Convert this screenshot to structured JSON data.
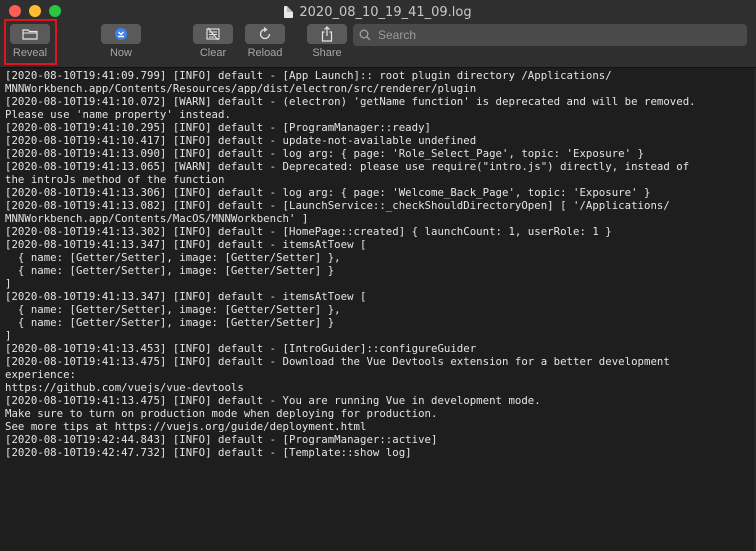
{
  "window": {
    "title": "2020_08_10_19_41_09.log"
  },
  "toolbar": {
    "items": [
      {
        "label": "Reveal",
        "icon": "folder-icon"
      },
      {
        "label": "Now",
        "icon": "now-icon"
      },
      {
        "label": "Clear",
        "icon": "clear-icon"
      },
      {
        "label": "Reload",
        "icon": "reload-icon"
      },
      {
        "label": "Share",
        "icon": "share-icon"
      }
    ],
    "search_placeholder": "Search"
  },
  "colors": {
    "toolbar_bg": "#2f2f2f",
    "log_bg": "#1e1e1e",
    "log_text": "#e4e4e4",
    "highlight": "#e0141b",
    "now_accent": "#3b82f6"
  },
  "log": {
    "lines": [
      "[2020-08-10T19:41:09.799] [INFO] default - [App Launch]:: root plugin directory /Applications/",
      "MNNWorkbench.app/Contents/Resources/app/dist/electron/src/renderer/plugin",
      "[2020-08-10T19:41:10.072] [WARN] default - (electron) 'getName function' is deprecated and will be removed.",
      "Please use 'name property' instead.",
      "[2020-08-10T19:41:10.295] [INFO] default - [ProgramManager::ready]",
      "[2020-08-10T19:41:10.417] [INFO] default - update-not-available undefined",
      "[2020-08-10T19:41:13.090] [INFO] default - log arg: { page: 'Role_Select_Page', topic: 'Exposure' }",
      "[2020-08-10T19:41:13.065] [WARN] default - Deprecated: please use require(\"intro.js\") directly, instead of",
      "the introJs method of the function",
      "[2020-08-10T19:41:13.306] [INFO] default - log arg: { page: 'Welcome_Back_Page', topic: 'Exposure' }",
      "[2020-08-10T19:41:13.082] [INFO] default - [LaunchService::_checkShouldDirectoryOpen] [ '/Applications/",
      "MNNWorkbench.app/Contents/MacOS/MNNWorkbench' ]",
      "[2020-08-10T19:41:13.302] [INFO] default - [HomePage::created] { launchCount: 1, userRole: 1 }",
      "[2020-08-10T19:41:13.347] [INFO] default - itemsAtToew [",
      "  { name: [Getter/Setter], image: [Getter/Setter] },",
      "  { name: [Getter/Setter], image: [Getter/Setter] }",
      "]",
      "[2020-08-10T19:41:13.347] [INFO] default - itemsAtToew [",
      "  { name: [Getter/Setter], image: [Getter/Setter] },",
      "  { name: [Getter/Setter], image: [Getter/Setter] }",
      "]",
      "[2020-08-10T19:41:13.453] [INFO] default - [IntroGuider]::configureGuider",
      "[2020-08-10T19:41:13.475] [INFO] default - Download the Vue Devtools extension for a better development",
      "experience:",
      "https://github.com/vuejs/vue-devtools",
      "[2020-08-10T19:41:13.475] [INFO] default - You are running Vue in development mode.",
      "Make sure to turn on production mode when deploying for production.",
      "See more tips at https://vuejs.org/guide/deployment.html",
      "[2020-08-10T19:42:44.843] [INFO] default - [ProgramManager::active]",
      "[2020-08-10T19:42:47.732] [INFO] default - [Template::show log]"
    ]
  }
}
